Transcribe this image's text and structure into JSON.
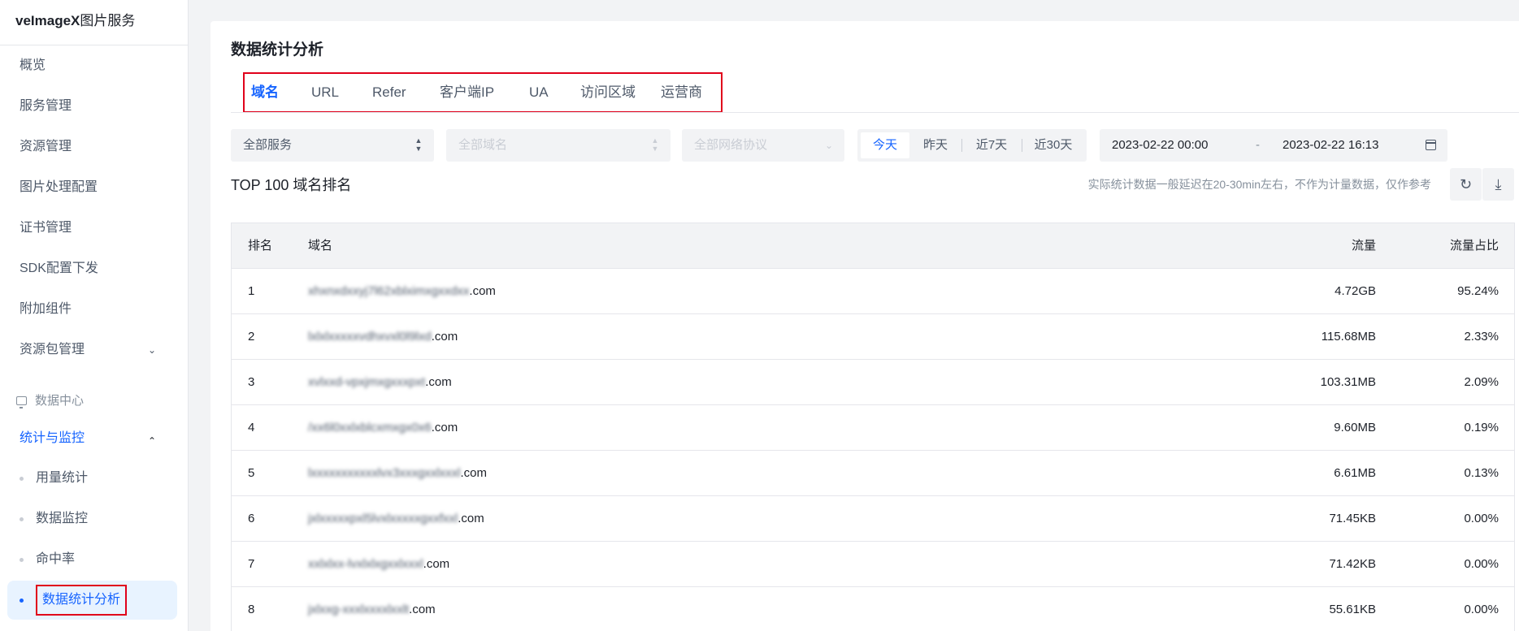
{
  "sidebar": {
    "brand_bold": "veImageX",
    "brand_rest": "图片服务",
    "items": [
      {
        "label": "概览"
      },
      {
        "label": "服务管理"
      },
      {
        "label": "资源管理"
      },
      {
        "label": "图片处理配置"
      },
      {
        "label": "证书管理"
      },
      {
        "label": "SDK配置下发"
      },
      {
        "label": "附加组件"
      },
      {
        "label": "资源包管理"
      }
    ],
    "group_label": "数据中心",
    "open_parent": "统计与监控",
    "sub_items": [
      {
        "label": "用量统计"
      },
      {
        "label": "数据监控"
      },
      {
        "label": "命中率"
      },
      {
        "label": "数据统计分析"
      }
    ]
  },
  "page": {
    "title": "数据统计分析",
    "tabs": [
      {
        "label": "域名"
      },
      {
        "label": "URL"
      },
      {
        "label": "Refer"
      },
      {
        "label": "客户端IP"
      },
      {
        "label": "UA"
      },
      {
        "label": "访问区域"
      },
      {
        "label": "运营商"
      }
    ]
  },
  "filters": {
    "service": "全部服务",
    "domain": "全部域名",
    "protocol": "全部网络协议",
    "ranges": [
      "今天",
      "昨天",
      "近7天",
      "近30天"
    ],
    "start": "2023-02-22 00:00",
    "separator": "-",
    "end": "2023-02-22 16:13"
  },
  "section": {
    "title": "TOP 100 域名排名",
    "note": "实际统计数据一般延迟在20-30min左右，不作为计量数据，仅作参考"
  },
  "table": {
    "headers": {
      "rank": "排名",
      "domain": "域名",
      "flow": "流量",
      "pct": "流量占比"
    },
    "rows": [
      {
        "rank": "1",
        "domain_masked": "xhxnxdxxyj7l62xblximxgxxdxx",
        "suffix": ".com",
        "flow": "4.72GB",
        "pct": "95.24%"
      },
      {
        "rank": "2",
        "domain_masked": "lxlxlxxxxxvdhxvxl0l9lxd",
        "suffix": ".com",
        "flow": "115.68MB",
        "pct": "2.33%"
      },
      {
        "rank": "3",
        "domain_masked": "xvlxxd-vpxjmxgxxxpxt",
        "suffix": ".com",
        "flow": "103.31MB",
        "pct": "2.09%"
      },
      {
        "rank": "4",
        "domain_masked": "/xx6l0xxlxblcxmxgx0x6",
        "suffix": ".com",
        "flow": "9.60MB",
        "pct": "0.19%"
      },
      {
        "rank": "5",
        "domain_masked": "lxxxxxxxxxxxlvx3xxxgxxlxxxl",
        "suffix": ".com",
        "flow": "6.61MB",
        "pct": "0.13%"
      },
      {
        "rank": "6",
        "domain_masked": "jxlxxxxxpxl5lvxlxxxxxgxxfxxl",
        "suffix": ".com",
        "flow": "71.45KB",
        "pct": "0.00%"
      },
      {
        "rank": "7",
        "domain_masked": "xxlxlxx-lvxlxlxgxxlxxxl",
        "suffix": ".com",
        "flow": "71.42KB",
        "pct": "0.00%"
      },
      {
        "rank": "8",
        "domain_masked": "jxlxxg-xxxlxxxxlxxlt",
        "suffix": ".com",
        "flow": "55.61KB",
        "pct": "0.00%"
      }
    ]
  }
}
